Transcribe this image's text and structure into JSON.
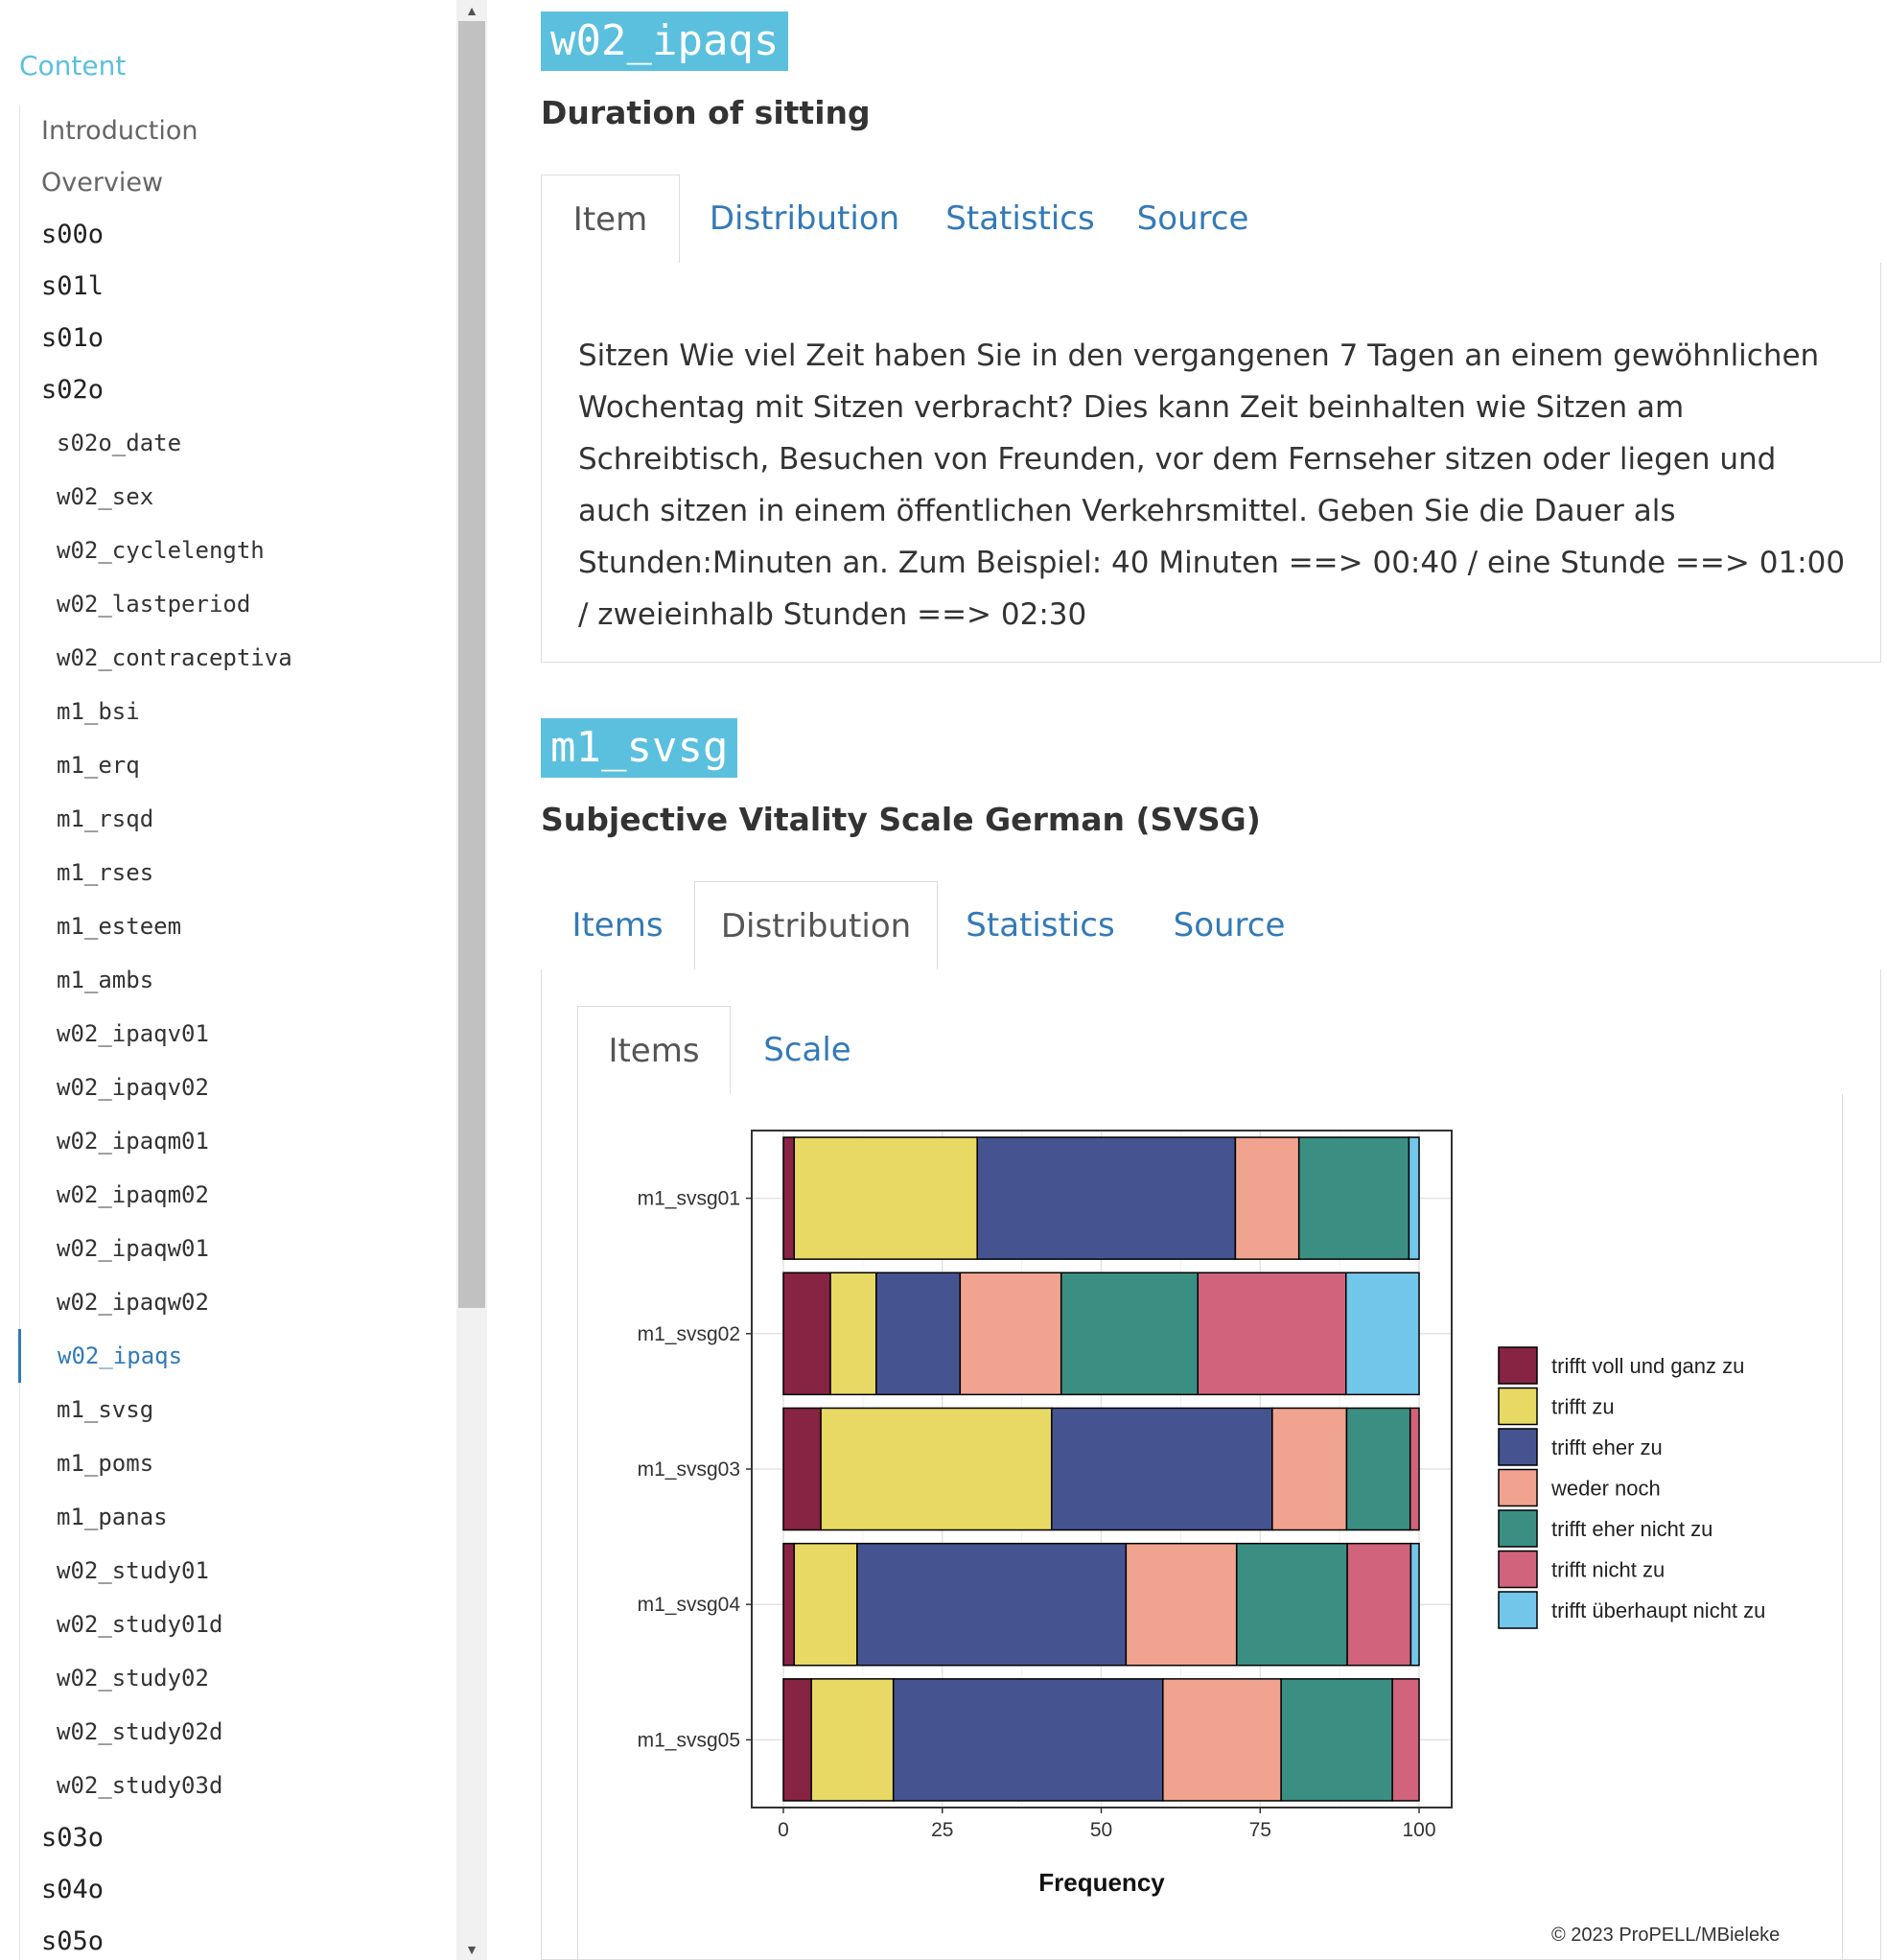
{
  "sidebar": {
    "heading": "Content",
    "items": [
      {
        "label": "Introduction",
        "level": 1,
        "kind": "text"
      },
      {
        "label": "Overview",
        "level": 1,
        "kind": "text"
      },
      {
        "label": "s00o",
        "level": 1
      },
      {
        "label": "s01l",
        "level": 1
      },
      {
        "label": "s01o",
        "level": 1
      },
      {
        "label": "s02o",
        "level": 1
      },
      {
        "label": "s02o_date",
        "level": 2
      },
      {
        "label": "w02_sex",
        "level": 2
      },
      {
        "label": "w02_cyclelength",
        "level": 2
      },
      {
        "label": "w02_lastperiod",
        "level": 2
      },
      {
        "label": "w02_contraceptiva",
        "level": 2
      },
      {
        "label": "m1_bsi",
        "level": 2
      },
      {
        "label": "m1_erq",
        "level": 2
      },
      {
        "label": "m1_rsqd",
        "level": 2
      },
      {
        "label": "m1_rses",
        "level": 2
      },
      {
        "label": "m1_esteem",
        "level": 2
      },
      {
        "label": "m1_ambs",
        "level": 2
      },
      {
        "label": "w02_ipaqv01",
        "level": 2
      },
      {
        "label": "w02_ipaqv02",
        "level": 2
      },
      {
        "label": "w02_ipaqm01",
        "level": 2
      },
      {
        "label": "w02_ipaqm02",
        "level": 2
      },
      {
        "label": "w02_ipaqw01",
        "level": 2
      },
      {
        "label": "w02_ipaqw02",
        "level": 2
      },
      {
        "label": "w02_ipaqs",
        "level": 2,
        "active": true
      },
      {
        "label": "m1_svsg",
        "level": 2
      },
      {
        "label": "m1_poms",
        "level": 2
      },
      {
        "label": "m1_panas",
        "level": 2
      },
      {
        "label": "w02_study01",
        "level": 2
      },
      {
        "label": "w02_study01d",
        "level": 2
      },
      {
        "label": "w02_study02",
        "level": 2
      },
      {
        "label": "w02_study02d",
        "level": 2
      },
      {
        "label": "w02_study03d",
        "level": 2
      },
      {
        "label": "s03o",
        "level": 1
      },
      {
        "label": "s04o",
        "level": 1
      },
      {
        "label": "s05o",
        "level": 1
      }
    ]
  },
  "section1": {
    "badge": "w02_ipaqs",
    "subtitle": "Duration of sitting",
    "tabs": [
      "Item",
      "Distribution",
      "Statistics",
      "Source"
    ],
    "active_tab": 0,
    "item_text": "Sitzen Wie viel Zeit haben Sie in den vergangenen 7 Tagen an einem gewöhnlichen Wochentag mit Sitzen verbracht? Dies kann Zeit beinhalten wie Sitzen am Schreibtisch, Besuchen von Freunden, vor dem Fernseher sitzen oder liegen und auch sitzen in einem öffentlichen Verkehrsmittel. Geben Sie die Dauer als Stunden:Minuten an. Zum Beispiel: 40 Minuten ==> 00:40 / eine Stunde ==> 01:00 / zweieinhalb Stunden ==> 02:30"
  },
  "section2": {
    "badge": "m1_svsg",
    "subtitle": "Subjective Vitality Scale German (SVSG)",
    "tabs": [
      "Items",
      "Distribution",
      "Statistics",
      "Source"
    ],
    "active_tab": 1,
    "subtabs": [
      "Items",
      "Scale"
    ],
    "active_subtab": 0,
    "copyright": "© 2023 ProPELL/MBieleke"
  },
  "colors": {
    "accent": "#5bc0de",
    "link": "#337ab7"
  },
  "chart_data": {
    "type": "bar",
    "orientation": "horizontal",
    "stacked": true,
    "categories": [
      "m1_svsg01",
      "m1_svsg02",
      "m1_svsg03",
      "m1_svsg04",
      "m1_svsg05"
    ],
    "xlabel": "Frequency",
    "ylabel": "",
    "xlim": [
      0,
      100
    ],
    "xticks": [
      0,
      25,
      50,
      75,
      100
    ],
    "legend_position": "right",
    "grid": true,
    "series": [
      {
        "name": "trifft voll und ganz zu",
        "color": "#872343",
        "values": [
          1.7,
          7.4,
          5.9,
          1.7,
          4.4
        ]
      },
      {
        "name": "trifft zu",
        "color": "#e8d964",
        "values": [
          28.8,
          7.2,
          36.3,
          9.9,
          12.9
        ]
      },
      {
        "name": "trifft eher zu",
        "color": "#455491",
        "values": [
          40.6,
          13.2,
          34.7,
          42.3,
          42.4
        ]
      },
      {
        "name": "weder noch",
        "color": "#f0a38e",
        "values": [
          10.0,
          15.9,
          11.7,
          17.4,
          18.6
        ]
      },
      {
        "name": "trifft eher nicht zu",
        "color": "#3b8f82",
        "values": [
          17.3,
          21.5,
          10.0,
          17.4,
          17.5
        ]
      },
      {
        "name": "trifft nicht zu",
        "color": "#d1637d",
        "values": [
          0.0,
          23.3,
          1.4,
          10.0,
          4.2
        ]
      },
      {
        "name": "trifft überhaupt nicht zu",
        "color": "#72c6ea",
        "values": [
          1.6,
          11.5,
          0.0,
          1.3,
          0.0
        ]
      }
    ]
  }
}
